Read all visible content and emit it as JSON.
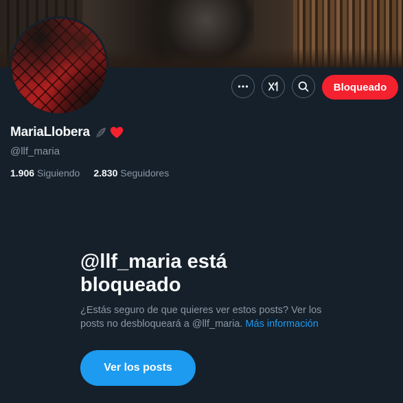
{
  "profile": {
    "display_name": "MariaLlobera",
    "handle": "@llf_maria",
    "following_count": "1.906",
    "following_label": "Siguiendo",
    "followers_count": "2.830",
    "followers_label": "Seguidores"
  },
  "actions": {
    "more_icon": "more-icon",
    "grok_icon": "grok-icon",
    "search_icon": "search-icon",
    "block_label": "Bloqueado",
    "block_color": "#f4212e"
  },
  "blocked": {
    "title": "@llf_maria está bloqueado",
    "description": "¿Estás seguro de que quieres ver estos posts? Ver los posts no desbloqueará a @llf_maria.",
    "more_info_link": "Más información",
    "view_button": "Ver los posts",
    "link_color": "#1d9bf0"
  },
  "theme": {
    "background": "#15202b",
    "text_primary": "#f7f9f9",
    "text_secondary": "#8b98a5"
  }
}
